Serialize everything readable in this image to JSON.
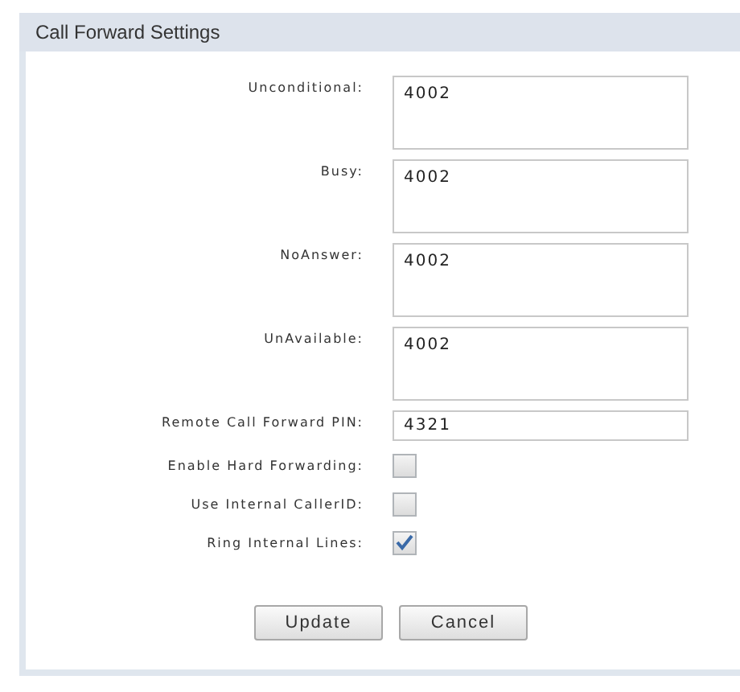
{
  "panel": {
    "title": "Call Forward Settings"
  },
  "fields": [
    {
      "kind": "textarea",
      "label": "Unconditional:",
      "value": "4002"
    },
    {
      "kind": "textarea",
      "label": "Busy:",
      "value": "4002"
    },
    {
      "kind": "textarea",
      "label": "NoAnswer:",
      "value": "4002"
    },
    {
      "kind": "textarea",
      "label": "UnAvailable:",
      "value": "4002"
    },
    {
      "kind": "text",
      "label": "Remote Call Forward PIN:",
      "value": "4321"
    },
    {
      "kind": "checkbox",
      "label": "Enable Hard Forwarding:",
      "checked": false
    },
    {
      "kind": "checkbox",
      "label": "Use Internal CallerID:",
      "checked": false
    },
    {
      "kind": "checkbox",
      "label": "Ring Internal Lines:",
      "checked": true
    }
  ],
  "buttons": [
    "Update",
    "Cancel"
  ]
}
